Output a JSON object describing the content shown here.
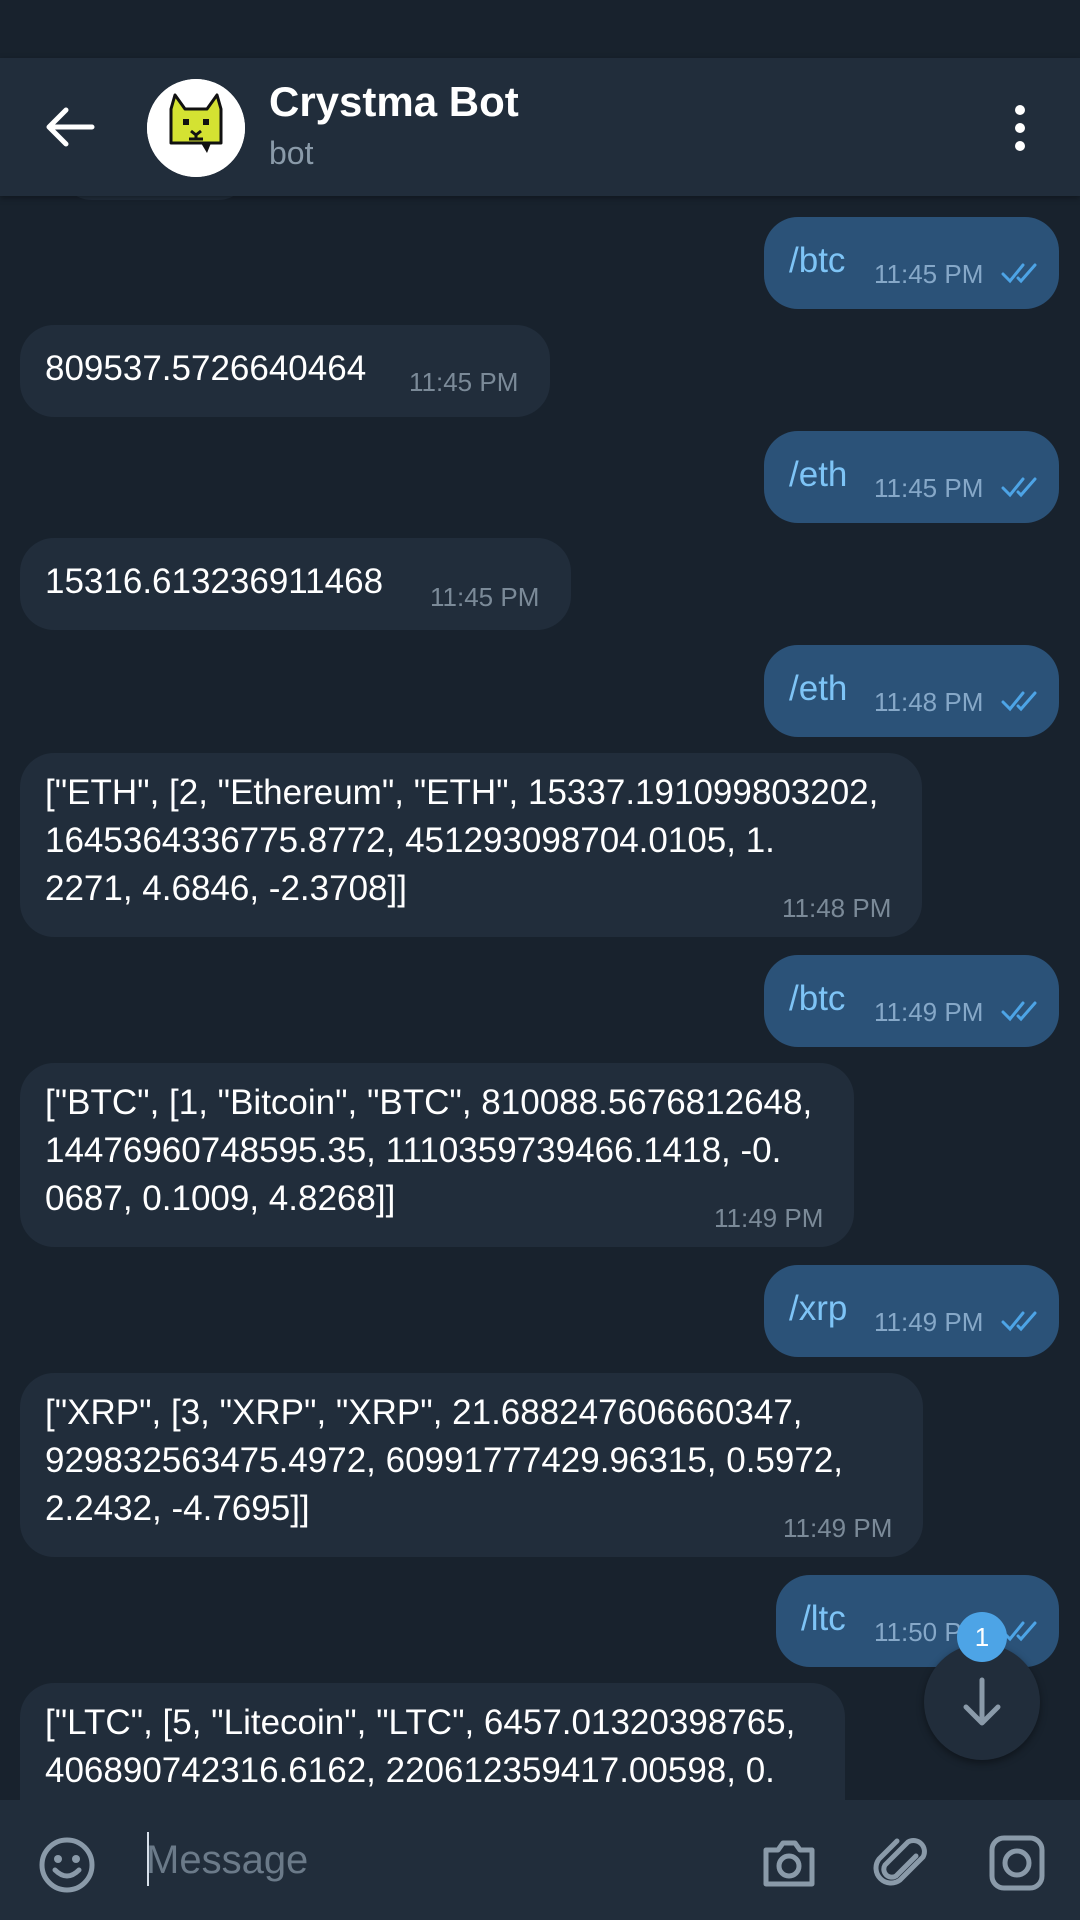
{
  "header": {
    "title": "Crystma Bot",
    "subtitle": "bot"
  },
  "messages": [
    {
      "dir": "out",
      "text": "/btc",
      "time": "11:45 PM"
    },
    {
      "dir": "in",
      "text": "809537.5726640464",
      "time": "11:45 PM"
    },
    {
      "dir": "out",
      "text": "/eth",
      "time": "11:45 PM"
    },
    {
      "dir": "in",
      "text": "15316.613236911468",
      "time": "11:45 PM"
    },
    {
      "dir": "out",
      "text": "/eth",
      "time": "11:48 PM"
    },
    {
      "dir": "in",
      "lines": [
        "[\"ETH\", [2, \"Ethereum\", \"ETH\", 15337.191099803202,",
        "1645364336775.8772, 451293098704.0105, 1.",
        "2271, 4.6846, -2.3708]]"
      ],
      "time": "11:48 PM"
    },
    {
      "dir": "out",
      "text": "/btc",
      "time": "11:49 PM"
    },
    {
      "dir": "in",
      "lines": [
        "[\"BTC\", [1, \"Bitcoin\", \"BTC\", 810088.5676812648,",
        "14476960748595.35, 1110359739466.1418, -0.",
        "0687, 0.1009, 4.8268]]"
      ],
      "time": "11:49 PM"
    },
    {
      "dir": "out",
      "text": "/xrp",
      "time": "11:49 PM"
    },
    {
      "dir": "in",
      "lines": [
        "[\"XRP\", [3, \"XRP\", \"XRP\", 21.688247606660347,",
        "929832563475.4972, 60991777429.96315, 0.5972,",
        "2.2432, -4.7695]]"
      ],
      "time": "11:49 PM"
    },
    {
      "dir": "out",
      "text": "/ltc",
      "time": "11:50 PM"
    },
    {
      "dir": "in",
      "lines": [
        "[\"LTC\", [5, \"Litecoin\", \"LTC\", 6457.01320398765,",
        "406890742316.6162, 220612359417.00598, 0."
      ]
    }
  ],
  "scroll_button": {
    "unread_count": "1"
  },
  "composer": {
    "placeholder": "Message"
  },
  "icons": {
    "back": "arrow-left-icon",
    "menu": "more-vert-icon",
    "read": "double-check-icon",
    "emoji": "emoji-icon",
    "camera": "camera-icon",
    "attach": "paperclip-icon",
    "instagram": "instagram-icon",
    "scroll": "arrow-down-icon"
  },
  "colors": {
    "background": "#18222d",
    "header": "#212d3b",
    "outgoing_bubble": "#2b5278",
    "incoming_bubble": "#212d3b",
    "accent": "#4da4e6",
    "avatar_yellow": "#d4e232"
  }
}
